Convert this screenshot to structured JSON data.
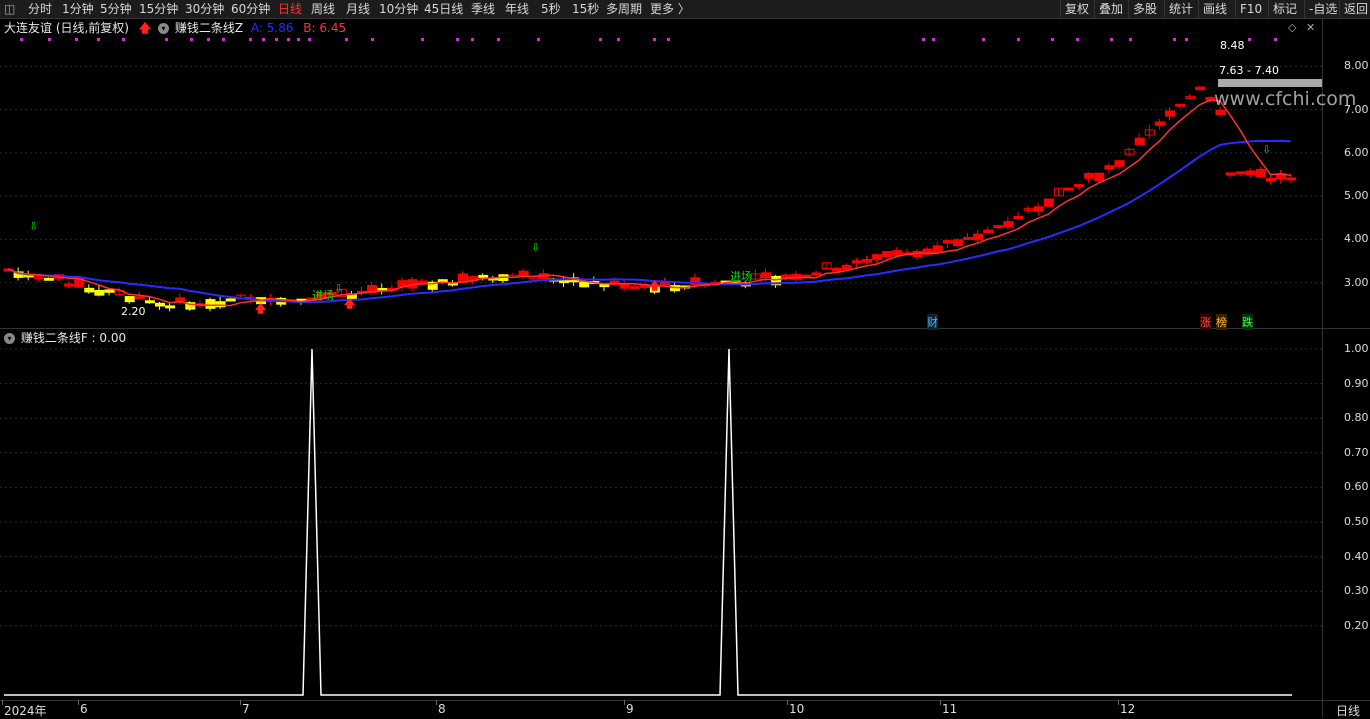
{
  "toolbar": {
    "left_items": [
      "分时",
      "1分钟",
      "5分钟",
      "15分钟",
      "30分钟",
      "60分钟",
      "日线",
      "周线",
      "月线",
      "10分钟",
      "45日线",
      "季线",
      "年线",
      "5秒",
      "15秒",
      "多周期",
      "更多 〉"
    ],
    "active_item": "日线",
    "right_items": [
      "复权",
      "叠加",
      "多股",
      "统计",
      "画线",
      "F10",
      "标记",
      "-自选",
      "返回"
    ]
  },
  "main_panel": {
    "stock_title": "大连友谊 (日线,前复权)",
    "indicator_name": "赚钱二条线Z",
    "a_label": "A: 5.86",
    "b_label": "B: 6.45",
    "a_color": "#2b2bff",
    "b_color": "#ff3030",
    "price_ticks": [
      "8.00",
      "7.00",
      "6.00",
      "5.00",
      "4.00",
      "3.00"
    ],
    "high_label": "8.48",
    "low_label": "2.20",
    "range_label": "7.63 - 7.40",
    "watermark": "www.cfchi.com",
    "enter_label": "进场",
    "event_cai": "财",
    "event_zhang": "涨",
    "event_bang": "榜",
    "event_die": "跌"
  },
  "sub_panel": {
    "title": "赚钱二条线F : 0.00",
    "ticks": [
      "1.00",
      "0.90",
      "0.80",
      "0.70",
      "0.60",
      "0.50",
      "0.40",
      "0.30",
      "0.20"
    ]
  },
  "date_axis": {
    "labels": [
      "2024年",
      "6",
      "7",
      "8",
      "9",
      "10",
      "11",
      "12"
    ],
    "period_label": "日线"
  },
  "chart_data": {
    "type": "candlestick",
    "main": {
      "y_range": [
        2.0,
        8.7
      ],
      "y_ticks": [
        3.0,
        4.0,
        5.0,
        6.0,
        7.0,
        8.0
      ],
      "series": [
        {
          "name": "A",
          "color": "#2b2bff"
        },
        {
          "name": "B",
          "color": "#ff3030"
        }
      ]
    },
    "sub": {
      "type": "line",
      "y_range": [
        0,
        1.0
      ],
      "y_ticks": [
        0.2,
        0.3,
        0.4,
        0.5,
        0.6,
        0.7,
        0.8,
        0.9,
        1.0
      ],
      "spikes": [
        {
          "month": "7",
          "value": 1.0
        },
        {
          "month": "9",
          "value": 1.0
        }
      ],
      "baseline": 0.0
    }
  },
  "colors": {
    "bull": "#ff0000",
    "bear": "#ffff00",
    "signal": "#00dd00",
    "dots": "#cc33cc",
    "sub_line": "#ffffff"
  }
}
